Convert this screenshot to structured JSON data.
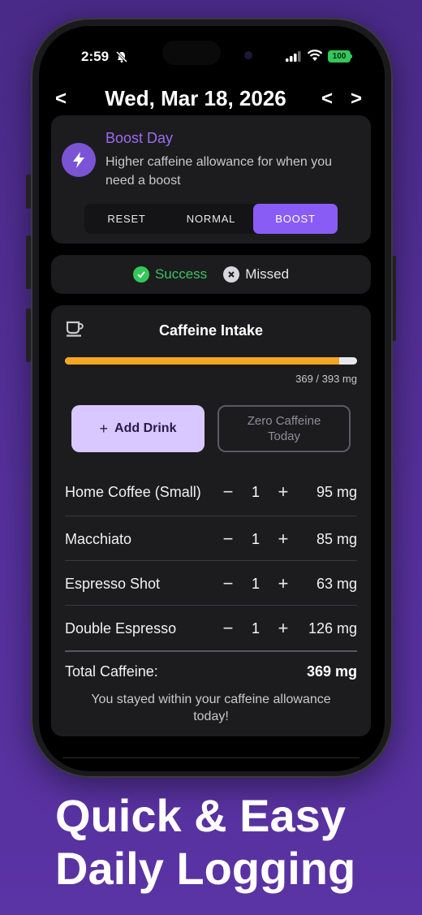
{
  "status_bar": {
    "time": "2:59",
    "battery": "100"
  },
  "header": {
    "date": "Wed, Mar 18, 2026",
    "prev_label": "<",
    "prev_day_label": "<",
    "next_day_label": ">"
  },
  "boost_card": {
    "title": "Boost Day",
    "description": "Higher caffeine allowance for when you need a boost",
    "modes": [
      "RESET",
      "NORMAL",
      "BOOST"
    ],
    "active_mode": "BOOST"
  },
  "result": {
    "success_label": "Success",
    "missed_label": "Missed"
  },
  "intake": {
    "title": "Caffeine Intake",
    "consumed_mg": 369,
    "allowance_mg": 393,
    "progress_text": "369 / 393 mg",
    "add_drink_label": "Add Drink",
    "zero_caffeine_label": "Zero Caffeine Today",
    "drinks": [
      {
        "name": "Home Coffee (Small)",
        "qty": "1",
        "mg": "95 mg"
      },
      {
        "name": "Macchiato",
        "qty": "1",
        "mg": "85 mg"
      },
      {
        "name": "Espresso Shot",
        "qty": "1",
        "mg": "63 mg"
      },
      {
        "name": "Double Espresso",
        "qty": "1",
        "mg": "126 mg"
      }
    ],
    "total_label": "Total Caffeine:",
    "total_value": "369 mg",
    "message": "You stayed within your caffeine allowance today!"
  },
  "promo": {
    "line1": "Quick & Easy",
    "line2": "Daily Logging"
  },
  "colors": {
    "accent": "#8a5cf6",
    "progress": "#f5a623",
    "success": "#34c759",
    "background": "#4a2a88"
  }
}
